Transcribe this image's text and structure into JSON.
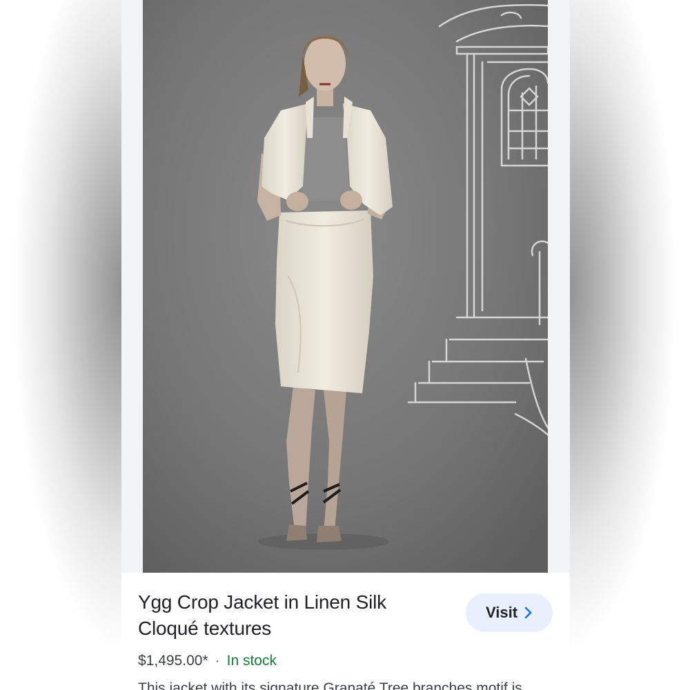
{
  "product": {
    "title_line1": "Ygg Crop Jacket in Linen Silk",
    "title_line2": "Cloqué textures",
    "price": "$1,495.00*",
    "separator": "·",
    "availability": "In stock",
    "description": "This jacket with its signature Granaté Tree branches motif is"
  },
  "actions": {
    "visit_label": "Visit",
    "visit_icon": "chevron-right-icon"
  },
  "colors": {
    "availability": "#188038",
    "visit_bg": "#e8f0fe",
    "visit_chevron": "#1a73e8",
    "photo_background": "#767676"
  }
}
